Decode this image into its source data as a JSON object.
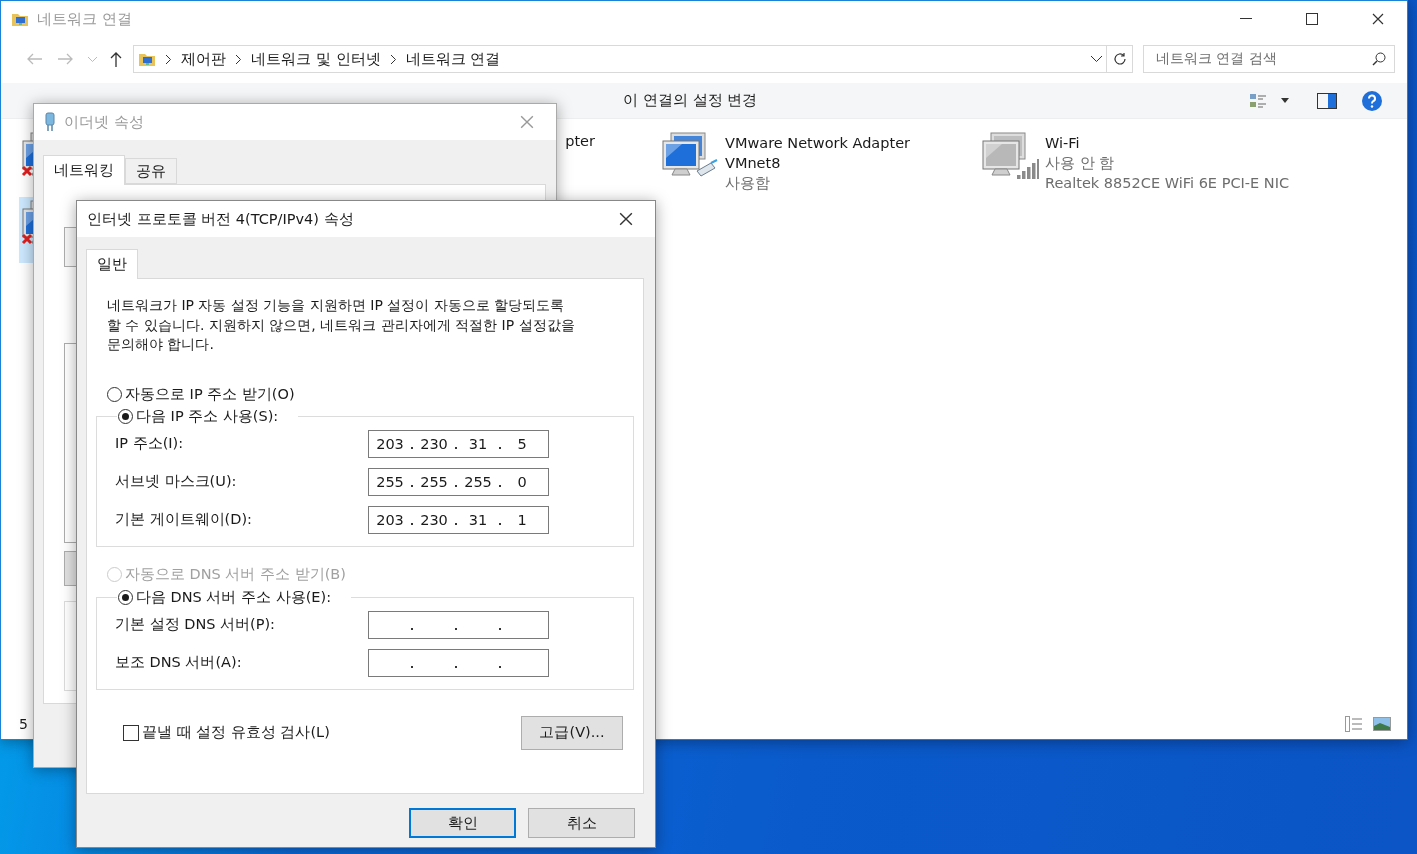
{
  "explorer": {
    "title": "네트워크 연결",
    "breadcrumbs": [
      "제어판",
      "네트워크 및 인터넷",
      "네트워크 연결"
    ],
    "search": {
      "placeholder": "네트워크 연결 검색"
    },
    "commands": [
      {
        "label": "이 연결의 설정 변경"
      }
    ],
    "adapters": [
      {
        "kind": "ethernet",
        "disconnected": true,
        "disabled": false,
        "selected": false
      },
      {
        "selected": false,
        "name": "pter"
      },
      {
        "kind": "ethernet",
        "disconnected": false,
        "disabled": false,
        "selected": false,
        "name": "VMware Network Adapter VMnet8",
        "status": "사용함"
      },
      {
        "kind": "wifi",
        "disconnected": false,
        "disabled": true,
        "selected": false,
        "name": "Wi-Fi",
        "status": "사용 안 함",
        "device": "Realtek 8852CE WiFi 6E PCI-E NIC"
      },
      {
        "kind": "ethernet",
        "disconnected": true,
        "disabled": false,
        "selected": true
      }
    ],
    "status_bar": "5"
  },
  "ethernet_dialog": {
    "title": "이더넷 속성",
    "tabs": [
      {
        "label": "네트워킹",
        "selected": true
      },
      {
        "label": "공유",
        "selected": false
      }
    ]
  },
  "ipv4_dialog": {
    "title": "인터넷 프로토콜 버전 4(TCP/IPv4) 속성",
    "tabs": [
      {
        "label": "일반",
        "selected": true
      }
    ],
    "description_lines": [
      "네트워크가 IP 자동 설정 기능을 지원하면 IP 설정이 자동으로 할당되도록",
      "할 수 있습니다. 지원하지 않으면, 네트워크 관리자에게 적절한 IP 설정값을",
      "문의해야 합니다."
    ],
    "ip_options": [
      {
        "label": "자동으로 IP 주소 받기(O)",
        "selected": false,
        "disabled": false
      },
      {
        "label": "다음 IP 주소 사용(S):",
        "selected": true,
        "disabled": false
      }
    ],
    "ip_fields": [
      {
        "label": "IP 주소(I):",
        "octets": [
          "203",
          "230",
          "31",
          "5"
        ]
      },
      {
        "label": "서브넷 마스크(U):",
        "octets": [
          "255",
          "255",
          "255",
          "0"
        ]
      },
      {
        "label": "기본 게이트웨이(D):",
        "octets": [
          "203",
          "230",
          "31",
          "1"
        ]
      }
    ],
    "dns_options": [
      {
        "label": "자동으로 DNS 서버 주소 받기(B)",
        "selected": false,
        "disabled": true
      },
      {
        "label": "다음 DNS 서버 주소 사용(E):",
        "selected": true,
        "disabled": false
      }
    ],
    "dns_fields": [
      {
        "label": "기본 설정 DNS 서버(P):"
      },
      {
        "label": "보조 DNS 서버(A):"
      }
    ],
    "validate": {
      "label": "끝낼 때 설정 유효성 검사(L)",
      "checked": false
    },
    "advanced_button": "고급(V)...",
    "buttons": [
      {
        "label": "확인",
        "default": true
      },
      {
        "label": "취소",
        "default": false
      }
    ]
  }
}
